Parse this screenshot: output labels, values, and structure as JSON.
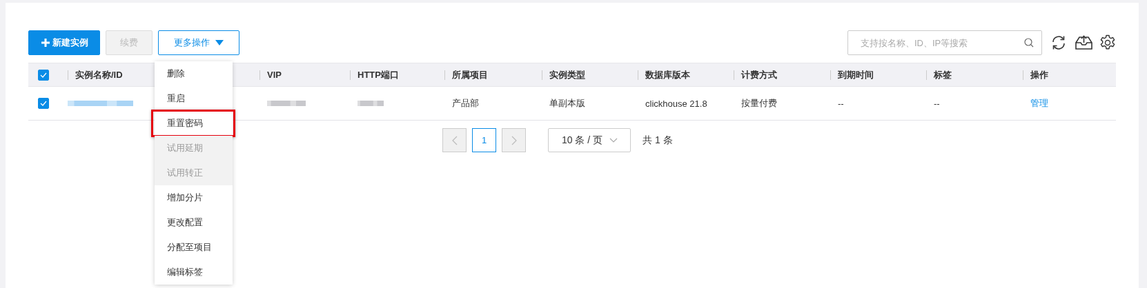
{
  "toolbar": {
    "buttons": [
      {
        "kind": "primary",
        "label": "新建实例",
        "disabled": false
      },
      {
        "kind": "default",
        "label": "续费",
        "disabled": true
      },
      {
        "kind": "dropdown",
        "label": "更多操作",
        "expanded": true
      }
    ],
    "search": {
      "placeholder": "支持按名称、ID、IP等搜索"
    }
  },
  "menu": {
    "items": [
      {
        "label": "删除",
        "disabled": false,
        "highlighted": false
      },
      {
        "label": "重启",
        "disabled": false,
        "highlighted": false
      },
      {
        "label": "重置密码",
        "disabled": false,
        "highlighted": true
      },
      {
        "label": "试用延期",
        "disabled": true,
        "highlighted": false
      },
      {
        "label": "试用转正",
        "disabled": true,
        "highlighted": false
      },
      {
        "label": "增加分片",
        "disabled": false,
        "highlighted": false
      },
      {
        "label": "更改配置",
        "disabled": false,
        "highlighted": false
      },
      {
        "label": "分配至项目",
        "disabled": false,
        "highlighted": false
      },
      {
        "label": "编辑标签",
        "disabled": false,
        "highlighted": false
      }
    ]
  },
  "table": {
    "all_checked": true,
    "columns": [
      "实例名称/ID",
      "VIP",
      "HTTP端口",
      "所属项目",
      "实例类型",
      "数据库版本",
      "计费方式",
      "到期时间",
      "标签",
      "操作"
    ],
    "rows": [
      {
        "checked": true,
        "cells": [
          {
            "kind": "redacted"
          },
          {
            "kind": "redacted"
          },
          {
            "kind": "redacted"
          },
          {
            "kind": "text",
            "text": "产品部"
          },
          {
            "kind": "text",
            "text": "单副本版"
          },
          {
            "kind": "text",
            "text": "clickhouse 21.8"
          },
          {
            "kind": "text",
            "text": "按量付费"
          },
          {
            "kind": "text",
            "text": "--"
          },
          {
            "kind": "text",
            "text": "--"
          },
          {
            "kind": "link",
            "text": "管理"
          }
        ]
      }
    ]
  },
  "pagination": {
    "pages": [
      {
        "label": "1",
        "selected": true
      }
    ],
    "page_size": "10 条 / 页",
    "total": "共 1 条"
  }
}
